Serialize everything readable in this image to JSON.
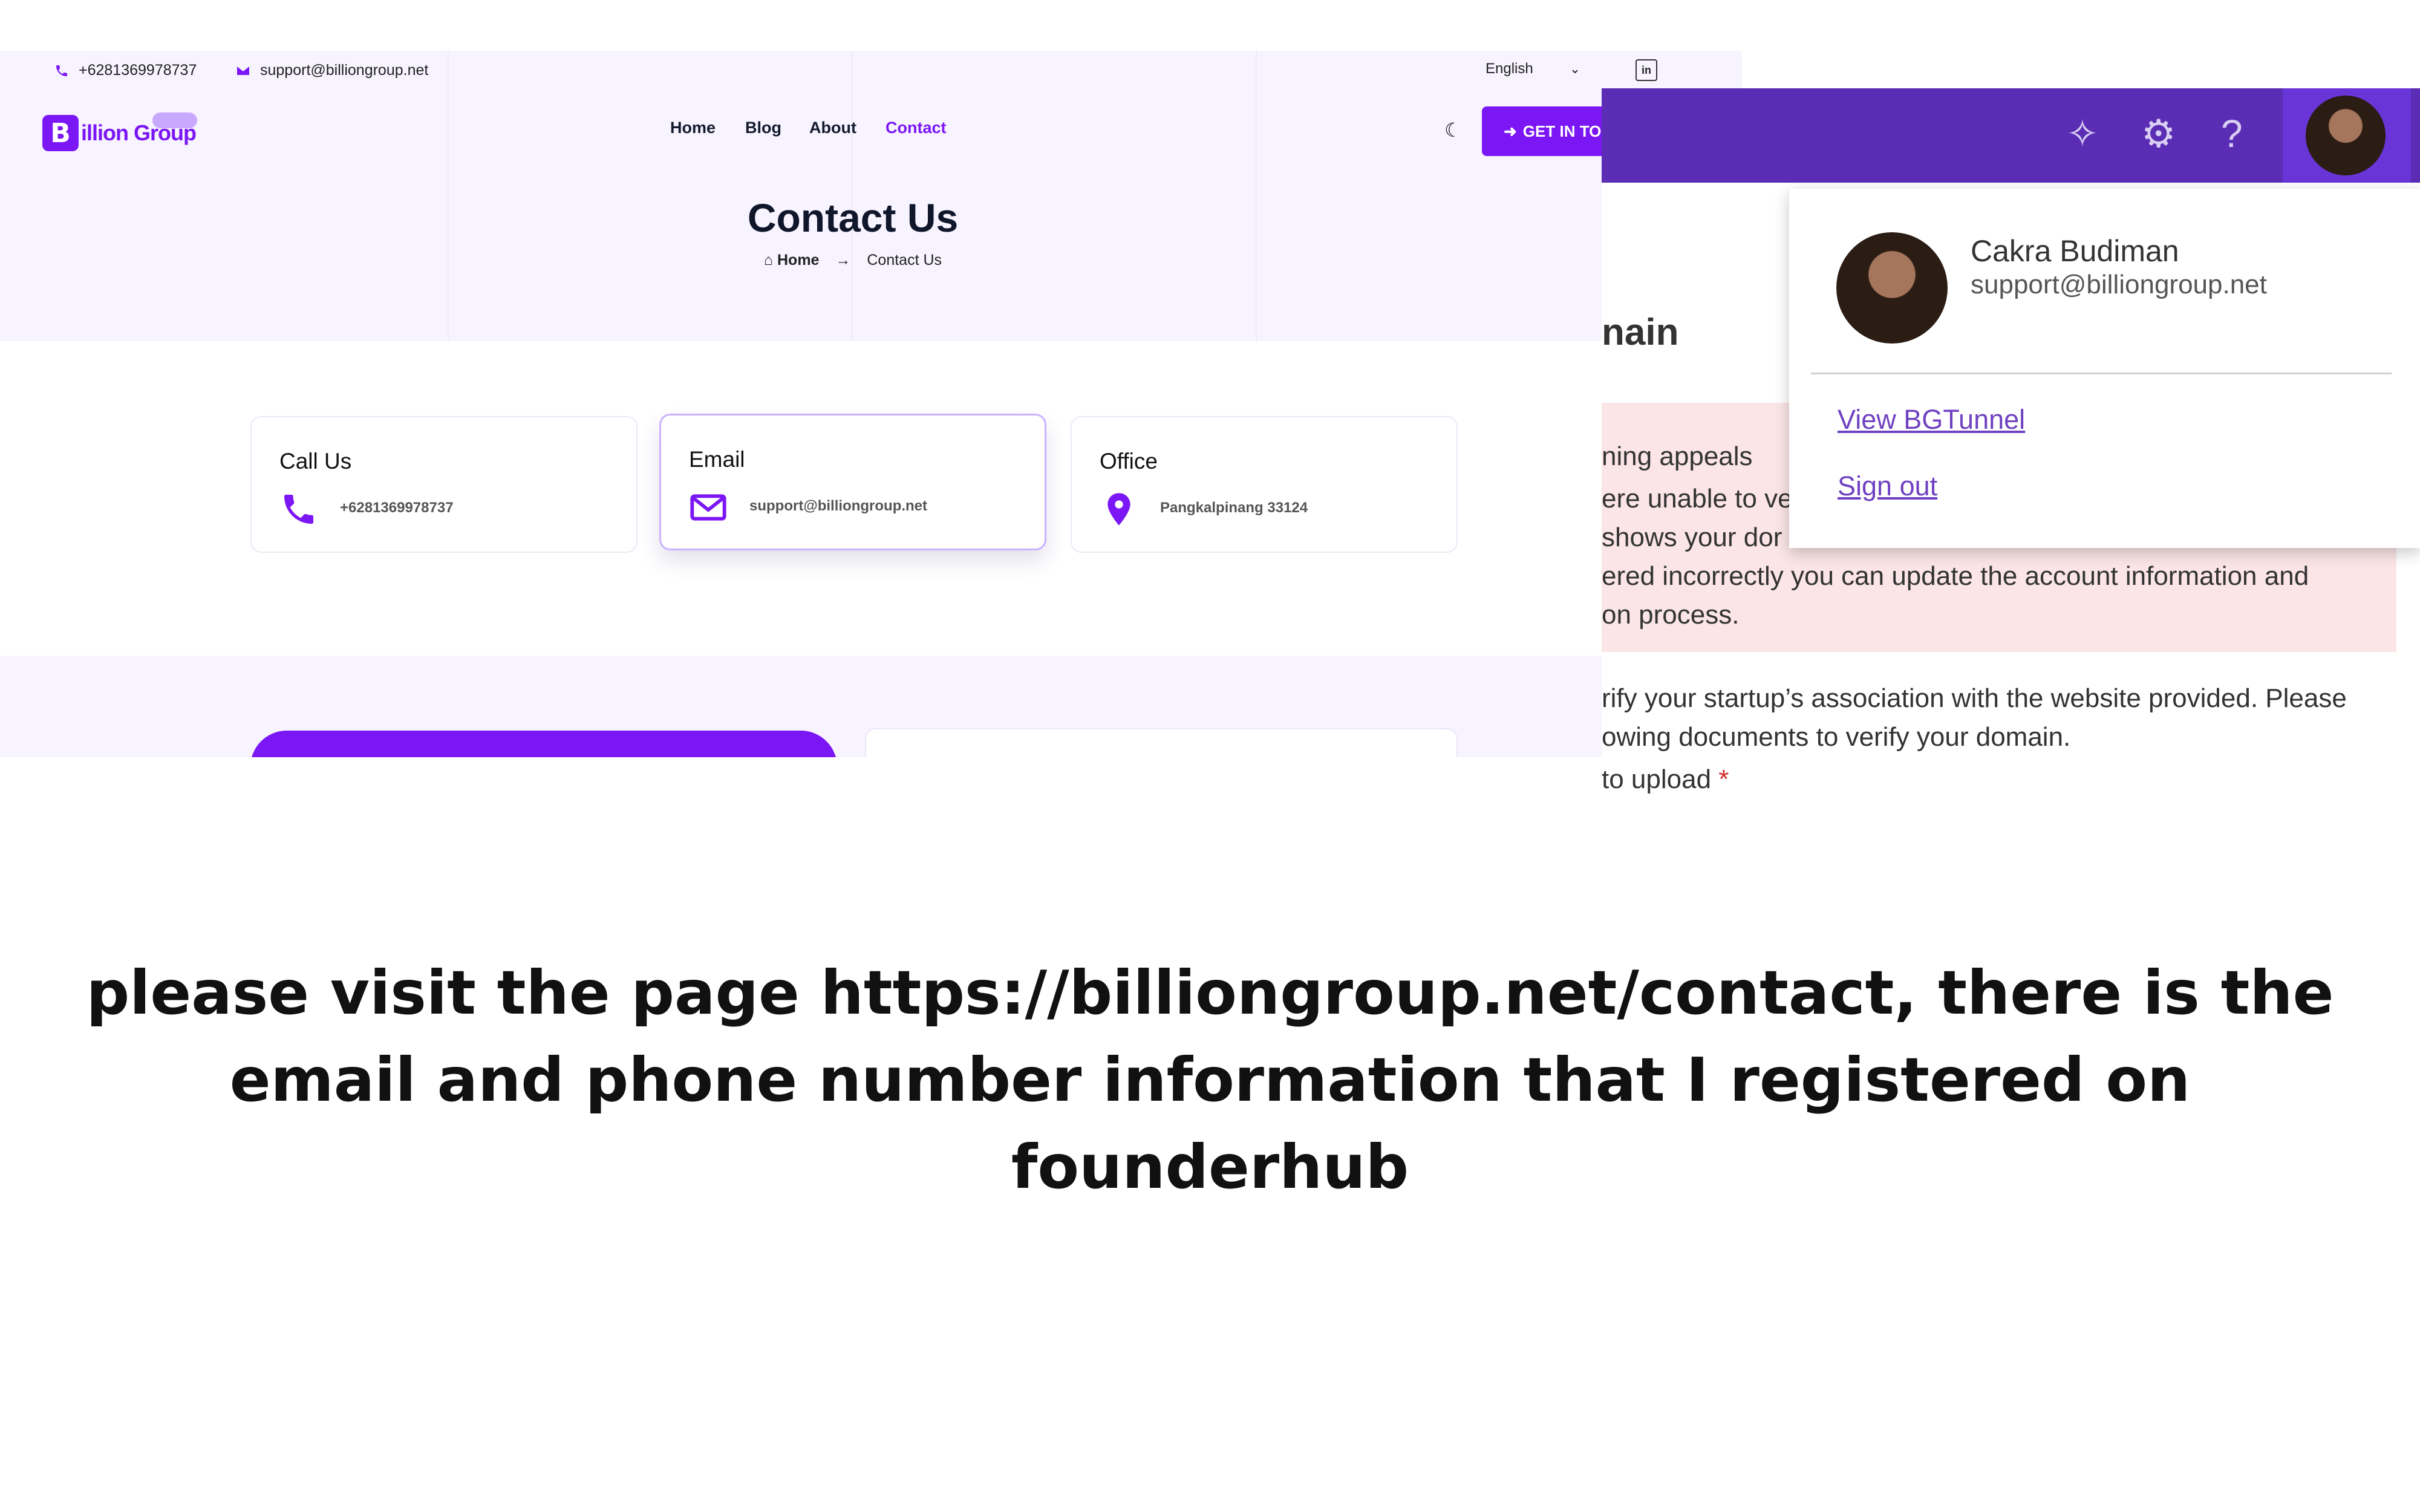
{
  "site": {
    "topbar": {
      "phone": "+6281369978737",
      "email": "support@billiongroup.net",
      "language": "English",
      "linkedin": "in"
    },
    "logo": {
      "mark": "B",
      "text": "illion Group"
    },
    "nav": [
      "Home",
      "Blog",
      "About",
      "Contact"
    ],
    "cta": "GET IN TOUCH",
    "page_title": "Contact Us",
    "breadcrumb": {
      "home": "Home",
      "current": "Contact Us"
    },
    "cards": [
      {
        "title": "Call Us",
        "value": "+6281369978737",
        "icon": "phone-icon"
      },
      {
        "title": "Email",
        "value": "support@billiongroup.net",
        "icon": "mail-icon"
      },
      {
        "title": "Office",
        "value": "Pangkalpinang 33124",
        "icon": "location-pin-icon"
      }
    ],
    "accent": "#7b16f5"
  },
  "panel": {
    "heading_fragment": "nain",
    "alert": {
      "title_fragment": "ning appeals",
      "line1": "ere unable to ve",
      "line2": " shows your dor",
      "line3": "ered incorrectly you can update the account information and",
      "line4": "on process."
    },
    "body_line1": "rify your startup’s association with the website provided. Please",
    "body_line2": "owing documents to verify your domain.",
    "upload_label": " to upload ",
    "required_mark": "*",
    "menu": {
      "name": "Cakra Budiman",
      "email": "support@billiongroup.net",
      "link1": "View BGTunnel",
      "link2": "Sign out"
    },
    "bar_color": "#5b2db4"
  },
  "caption": {
    "line1": "please visit the page https://billiongroup.net/contact, there is the",
    "line2": "email and phone number information that I registered on",
    "line3": "founderhub"
  }
}
